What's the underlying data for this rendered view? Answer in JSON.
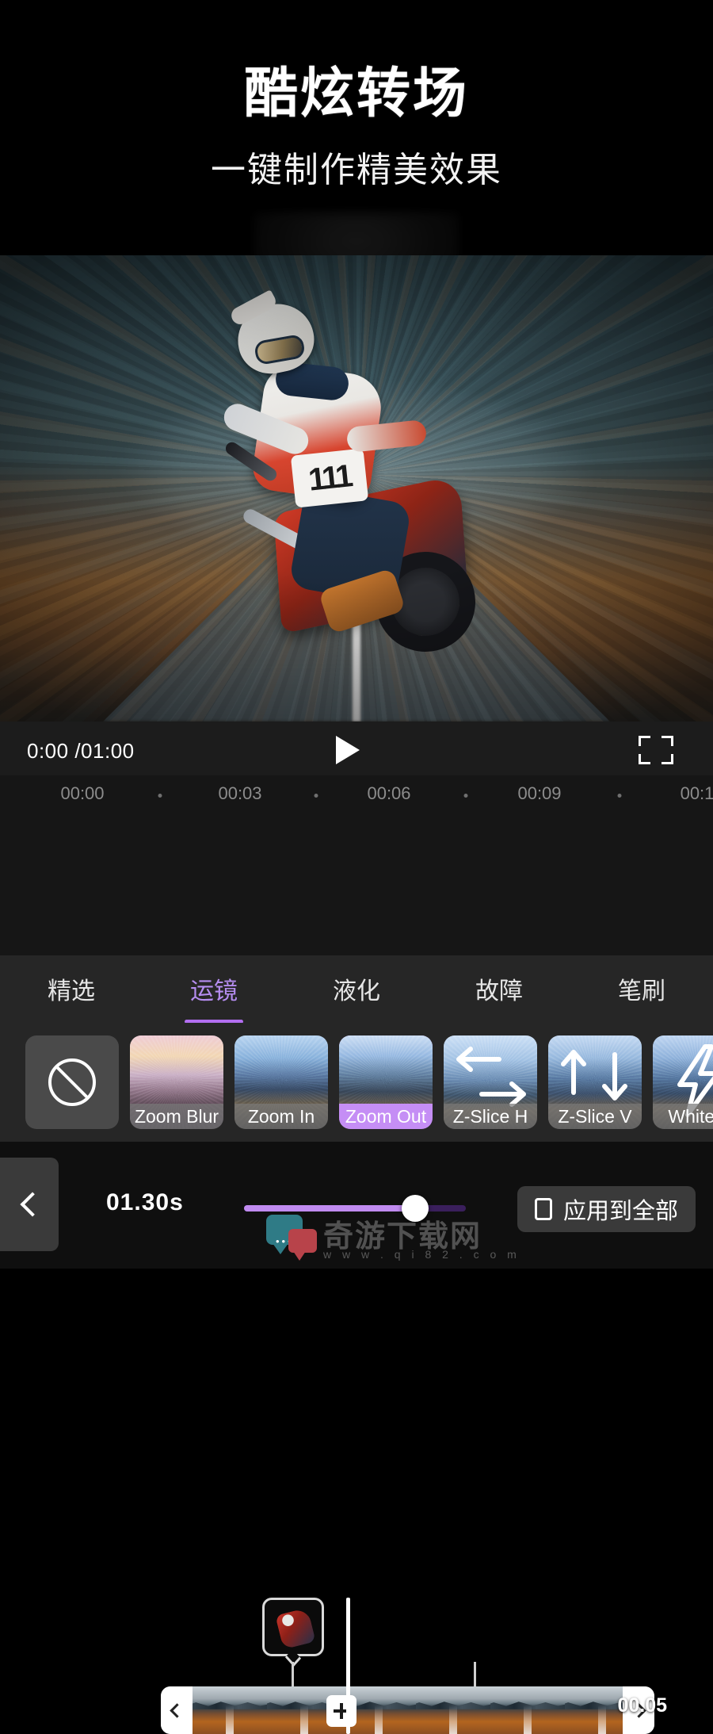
{
  "promo": {
    "title": "酷炫转场",
    "subtitle": "一键制作精美效果"
  },
  "player": {
    "time_label": "0:00 /01:00",
    "play_icon": "play-triangle-icon",
    "fullscreen_icon": "fullscreen-icon"
  },
  "timeline": {
    "ruler_marks": [
      "00:00",
      "00:03",
      "00:06",
      "00:09",
      "00:1"
    ],
    "clip_duration_badge": "00.05",
    "transition_icon": "plus-icon",
    "left_handle_icon": "chevron-left-icon",
    "right_handle_icon": "chevron-right-icon",
    "preview_thumb_name": "frame-preview-thumbnail"
  },
  "tabs": [
    {
      "label": "精选",
      "active": false
    },
    {
      "label": "运镜",
      "active": true
    },
    {
      "label": "液化",
      "active": false
    },
    {
      "label": "故障",
      "active": false
    },
    {
      "label": "笔刷",
      "active": false
    }
  ],
  "effects": [
    {
      "label": "",
      "kind": "none",
      "selected": false,
      "icon": "no-effect-icon"
    },
    {
      "label": "Zoom Blur",
      "kind": "thumb",
      "selected": false,
      "icon": ""
    },
    {
      "label": "Zoom In",
      "kind": "thumb",
      "selected": false,
      "icon": ""
    },
    {
      "label": "Zoom Out",
      "kind": "thumb",
      "selected": true,
      "icon": ""
    },
    {
      "label": "Z-Slice H",
      "kind": "thumb",
      "selected": false,
      "icon": "arrows-horizontal-icon"
    },
    {
      "label": "Z-Slice V",
      "kind": "thumb",
      "selected": false,
      "icon": "arrows-vertical-icon"
    },
    {
      "label": "White F",
      "kind": "thumb",
      "selected": false,
      "icon": "lightning-bolt-icon"
    }
  ],
  "bottom": {
    "back_icon": "back-chevron-icon",
    "duration_value": "01.30s",
    "slider_percent": 77,
    "apply_all_label": "应用到全部",
    "apply_all_checkbox_icon": "checkbox-icon"
  },
  "watermark": {
    "brand": "奇游下载网",
    "url": "w w w . q i 8 2 . c o m",
    "dots": "•••"
  },
  "colors": {
    "accent_purple": "#b26ef0",
    "accent_light": "#c58ef5",
    "panel_bg": "#262626",
    "timeline_bg": "#161616",
    "bottom_bg": "#0f0f0f"
  }
}
